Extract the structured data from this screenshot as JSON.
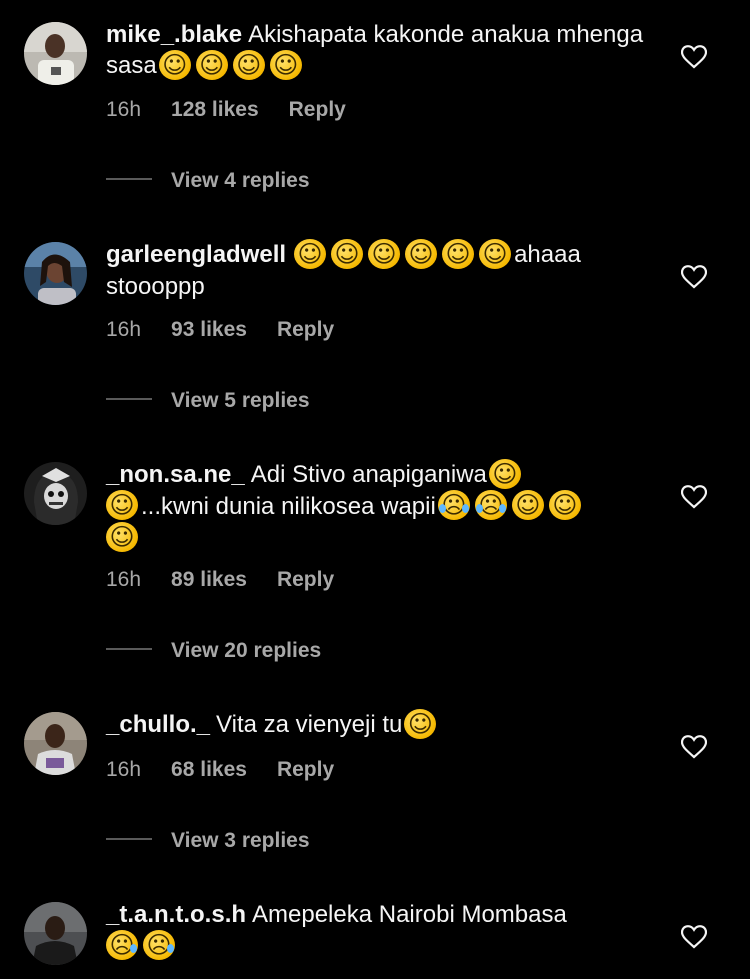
{
  "comments": [
    {
      "username": "mike_.blake",
      "text": "Akishapata kakonde anakua mhenga sasa",
      "trailing_emojis": [
        "tears-of-joy",
        "tears-of-joy",
        "tears-of-joy",
        "tears-of-joy"
      ],
      "time": "16h",
      "likes": "128 likes",
      "reply": "Reply",
      "view_replies": "View 4 replies"
    },
    {
      "username": "garleengladwell",
      "text": "ahaaa stoooppp",
      "leading_emojis": [
        "tears-of-joy",
        "tears-of-joy",
        "tears-of-joy",
        "tears-of-joy",
        "tears-of-joy",
        "tears-of-joy"
      ],
      "time": "16h",
      "likes": "93 likes",
      "reply": "Reply",
      "view_replies": "View 5 replies"
    },
    {
      "username": "_non.sa.ne_",
      "text_part1": "Adi Stivo anapiganiwa",
      "text_part2": "...kwni dunia nilikosea wapii",
      "time": "16h",
      "likes": "89 likes",
      "reply": "Reply",
      "view_replies": "View 20 replies"
    },
    {
      "username": "_chullo._",
      "text": "Vita za vienyeji tu",
      "trailing_emojis": [
        "tears-of-joy"
      ],
      "time": "16h",
      "likes": "68 likes",
      "reply": "Reply",
      "view_replies": "View 3 replies"
    },
    {
      "username": "_t.a.n.t.o.s.h",
      "text": "Amepeleka Nairobi Mombasa",
      "trailing_emojis": [
        "crying-face",
        "crying-face"
      ]
    }
  ],
  "icons": {
    "like": "heart-outline-icon",
    "laugh_emoji": "tears-of-joy",
    "sob_emoji": "loudly-crying-face",
    "cry_emoji": "crying-face"
  },
  "colors": {
    "background": "#000000",
    "text": "#f5f5f5",
    "meta": "#a8a8a8",
    "divider": "#5a5a5a"
  }
}
